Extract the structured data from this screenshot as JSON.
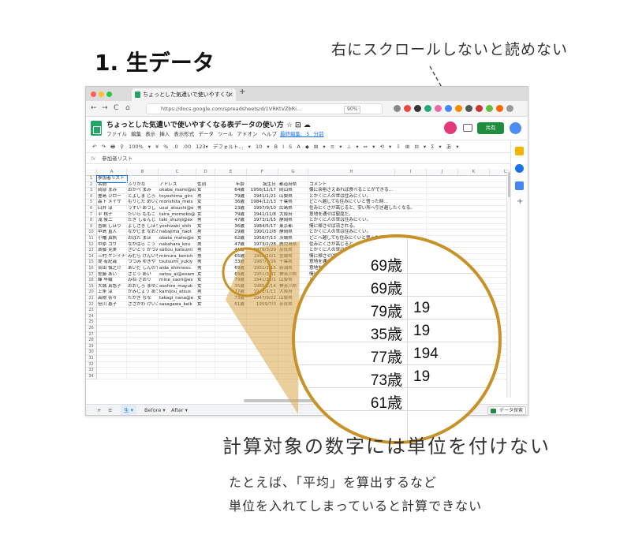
{
  "heading": "1. 生データ",
  "top_note": "右にスクロールしないと読めない",
  "browser": {
    "tab_title": "ちょっとした気遣いで使いやすくな",
    "tab_close": "×",
    "new_tab": "+",
    "url": "https://docs.google.com/spreadsheets/d/1VRKtVZbRi...",
    "zoom": "90%",
    "nav": {
      "back": "←",
      "forward": "→",
      "reload": "C",
      "home": "⌂"
    }
  },
  "sheets_header": {
    "doc_title": "ちょっとした気遣いで使いやすくなる表データの使い方 ☆ ⊡ ☁",
    "menus": "ファイル 編集 表示 挿入 表示形式 データ ツール アドオン ヘルプ",
    "last_edit": "最終編集: 5 分前",
    "share_label": "共有"
  },
  "toolbar": {
    "items": "↶ ↷ 🖶 ⚲ 100% ▾ ¥ % .0 .00 123▾ デフォルト... ▾ 10 ▾ B I S A ◆ ⊞ ▾ ≡ ▾ ⊥ ▾ ⇔ ▾ ⟲ ▾ ⇩ ⊞ ⊟ ▾ Σ ▾ あ ▾"
  },
  "formula_bar": {
    "fx": "fx",
    "value": "参加者リスト"
  },
  "columns": [
    "A",
    "B",
    "C",
    "D",
    "E",
    "F",
    "G",
    "H",
    "I",
    "J",
    "K",
    "L",
    "M"
  ],
  "rows": [
    [
      "参加者リスト",
      "",
      "",
      "",
      "",
      "",
      "",
      "",
      ""
    ],
    [
      "名前",
      "ふりがな",
      "アドレス",
      "性別",
      "年齢",
      "誕生日",
      "都道府県",
      "コメント",
      ""
    ],
    [
      "岡部 まみ",
      "おかべ まみ",
      "okabe_mami@ex",
      "女",
      "64歳",
      "1956/11/17",
      "岡山県",
      "懐に余裕さえあれば食べることができる…",
      ""
    ],
    [
      "豊島 ジロー",
      "とよしま じろ",
      "toyoshima_girc",
      "男",
      "79歳",
      "1941/1/21",
      "山梨県",
      "とかくに人の世は住みにくい。",
      ""
    ],
    [
      "森下 メイサ",
      "もりした めいさ",
      "morishita_meis",
      "女",
      "36歳",
      "1984/12/13",
      "千葉県",
      "どこへ越しても住みにくいと悟った時…",
      ""
    ],
    [
      "臼井 淳",
      "うすい あつし",
      "usui_atsushi@e",
      "男",
      "23歳",
      "1997/9/10",
      "広島県",
      "住みにくさが高じると、安い所へ引き越したくなる。",
      ""
    ],
    [
      "平 桃子",
      "たいら ももこ",
      "taira_momoko@",
      "女",
      "79歳",
      "1941/11/8",
      "大阪府",
      "意地を通せば窮屈だ。",
      ""
    ],
    [
      "滝 俊二",
      "たき しゅんじ",
      "taki_shunji@ex",
      "男",
      "47歳",
      "1973/1/15",
      "静岡県",
      "とかくに人の世は住みにくい。",
      ""
    ],
    [
      "吉嶋 しほり",
      "よしざき しほり",
      "yoshizaki_shih",
      "女",
      "36歳",
      "1984/5/17",
      "東京都",
      "情に棹させば流される。",
      ""
    ],
    [
      "中島 直人",
      "なかじま なおと",
      "nakajima_naot",
      "男",
      "29歳",
      "1991/12/8",
      "静岡県",
      "とかくに人の世は住みにくい。",
      ""
    ],
    [
      "小幡 真帆",
      "おばた まほ",
      "obata_maho@e",
      "女",
      "62歳",
      "1958/7/13",
      "茨城県",
      "どこへ越しても住みにくいと悟った時…",
      ""
    ],
    [
      "中原 コウ",
      "なかはら こう",
      "nakahara_kou",
      "男",
      "47歳",
      "1973/2/28",
      "鹿児島県",
      "住みにくさが高じると…",
      ""
    ],
    [
      "斎藤 克実",
      "さいとう かつみ",
      "saitou_katsumi",
      "男",
      "41歳",
      "1979/3/29",
      "奈良県",
      "とかくに人の世は住みにくい。",
      ""
    ],
    [
      "三村 ケンイチ",
      "みむら けんいち",
      "mimura_kenich",
      "男",
      "65歳",
      "1955/10/1",
      "宮城県",
      "情に棹させば流される。",
      ""
    ],
    [
      "堤 有紀哉",
      "つつみ ゆきや",
      "tsutsumi_yukiy",
      "男",
      "33歳",
      "1987/7/26",
      "千葉県",
      "意地を通せば窮屈だ。",
      ""
    ],
    [
      "合田 慎之介",
      "あいだ しんのすけ",
      "aida_shinnosu",
      "男",
      "69歳",
      "1951/1/15",
      "新潟県",
      "意地を通せば窮屈だ。",
      ""
    ],
    [
      "佐藤 あい",
      "さとう あい",
      "satou_ai@exam",
      "女",
      "69歳",
      "1951/3/31",
      "神奈川県",
      "情に棹させば流される。",
      ""
    ],
    [
      "峰 早織",
      "みね さおり",
      "mine_saori@ex",
      "女",
      "79歳",
      "1941/12/1",
      "山梨県",
      "とかくに人の世は住みにくい。",
      ""
    ],
    [
      "大城 真悠子",
      "おおしろ まゆこ",
      "ooshiro_mayuk",
      "女",
      "35歳",
      "1985/1/14",
      "神奈川県",
      "とかくに人の世は住みにくい。",
      ""
    ],
    [
      "上条 淳",
      "かみじょう あつし",
      "kamijou_atsus",
      "男",
      "77歳",
      "1943/1/11",
      "大阪府",
      "どこへ越しても住みにくい…",
      ""
    ],
    [
      "高樹 奈々",
      "たかぎ なな",
      "takagi_nana@e",
      "女",
      "73歳",
      "1947/9/22",
      "山梨県",
      "情に棹させば流される。",
      ""
    ],
    [
      "笹川 恵子",
      "ささがわ けいこ",
      "sasagawa_keik",
      "女",
      "61歳",
      "1959/7/3",
      "奈良県",
      "",
      ""
    ]
  ],
  "sheet_tabs": {
    "add": "+",
    "list": "≡",
    "raw": "生 ▾",
    "before": "Before ▾",
    "after": "After ▾",
    "explore": "データ探索"
  },
  "magnifier": {
    "ages": [
      "69歳",
      "69歳",
      "79歳",
      "35歳",
      "77歳",
      "73歳",
      "61歳"
    ],
    "births": [
      "",
      "",
      "19",
      "19",
      "194",
      "19",
      ""
    ]
  },
  "main_note": "計算対象の数字には単位を付けない",
  "sub_notes": [
    "たとえば、「平均」を算出するなど",
    "単位を入れてしまっていると計算できない"
  ]
}
